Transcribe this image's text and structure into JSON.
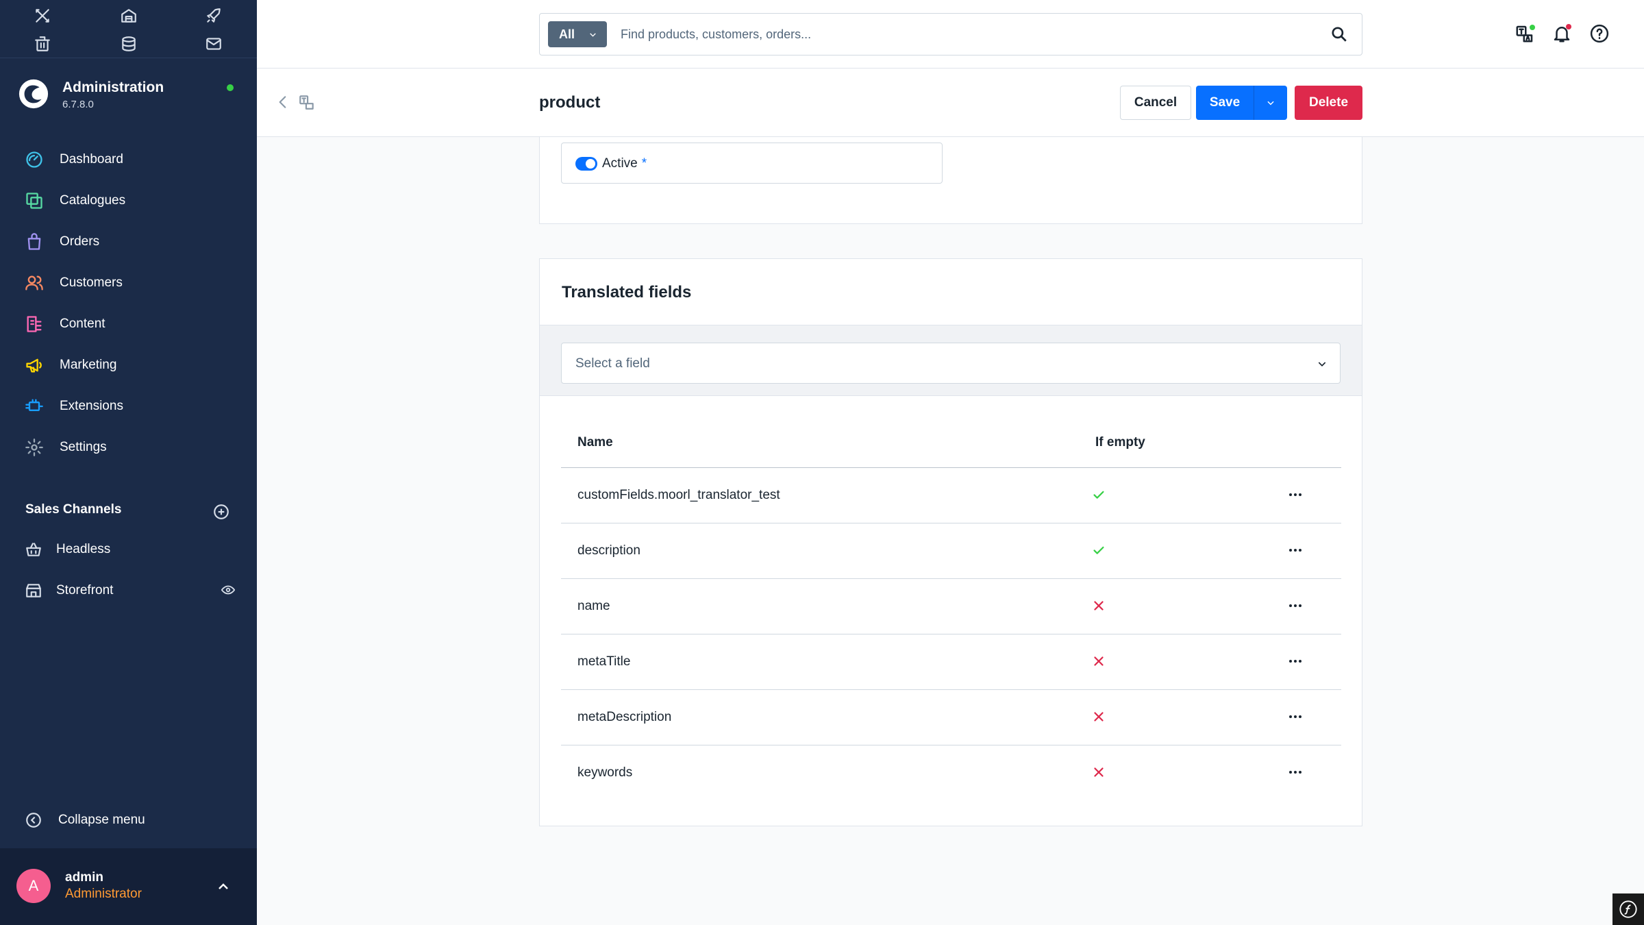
{
  "app": {
    "title": "Administration",
    "version": "6.7.8.0",
    "accent": "#0870ff"
  },
  "quick_actions": [
    "tools-icon",
    "warehouse-icon",
    "rocket-icon",
    "trash-icon",
    "database-icon",
    "mail-icon"
  ],
  "sidebar": {
    "items": [
      {
        "label": "Dashboard",
        "icon": "dashboard-icon",
        "color": "#3fc2e8"
      },
      {
        "label": "Catalogues",
        "icon": "catalogues-icon",
        "color": "#57d9a3"
      },
      {
        "label": "Orders",
        "icon": "orders-icon",
        "color": "#a092f0"
      },
      {
        "label": "Customers",
        "icon": "customers-icon",
        "color": "#f88962"
      },
      {
        "label": "Content",
        "icon": "content-icon",
        "color": "#ff68b4"
      },
      {
        "label": "Marketing",
        "icon": "marketing-icon",
        "color": "#ffd700"
      },
      {
        "label": "Extensions",
        "icon": "extensions-icon",
        "color": "#189eff"
      },
      {
        "label": "Settings",
        "icon": "settings-icon",
        "color": "#9aa8b5"
      }
    ],
    "sales_channels_title": "Sales Channels",
    "sales_channels": [
      {
        "label": "Headless",
        "icon": "basket-icon"
      },
      {
        "label": "Storefront",
        "icon": "storefront-icon"
      }
    ],
    "collapse_label": "Collapse menu"
  },
  "user": {
    "initial": "A",
    "name": "admin",
    "role": "Administrator"
  },
  "search": {
    "type_label": "All",
    "placeholder": "Find products, customers, orders..."
  },
  "smartbar": {
    "title": "product",
    "cancel_label": "Cancel",
    "save_label": "Save",
    "delete_label": "Delete"
  },
  "active_field": {
    "label": "Active",
    "required_mark": "*",
    "checked": true
  },
  "translated_fields": {
    "title": "Translated fields",
    "select_placeholder": "Select a field",
    "columns": [
      "Name",
      "If empty"
    ],
    "rows": [
      {
        "name": "customFields.moorl_translator_test",
        "if_empty": true
      },
      {
        "name": "description",
        "if_empty": true
      },
      {
        "name": "name",
        "if_empty": false
      },
      {
        "name": "metaTitle",
        "if_empty": false
      },
      {
        "name": "metaDescription",
        "if_empty": false
      },
      {
        "name": "keywords",
        "if_empty": false
      }
    ]
  },
  "colors": {
    "success": "#37d046",
    "danger": "#de294c",
    "sidebar_bg": "#1b2b48"
  }
}
